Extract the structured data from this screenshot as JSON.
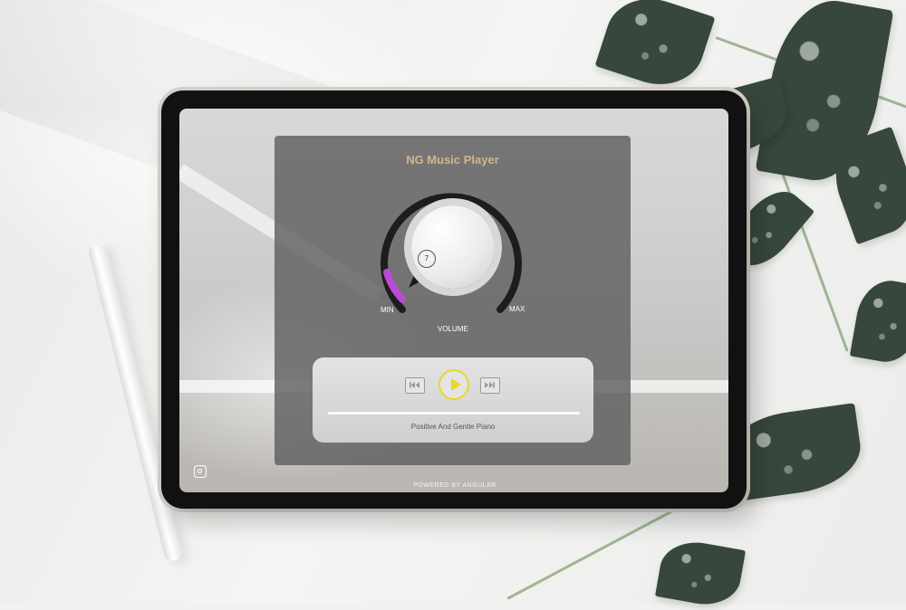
{
  "app": {
    "title": "NG Music Player",
    "footer": "POWERED BY ANGULAR"
  },
  "volume": {
    "label": "VOLUME",
    "min_label": "MIN",
    "max_label": "MAX",
    "value": "7",
    "level_fraction": 0.1
  },
  "controls": {
    "previous_icon": "skip-previous-icon",
    "play_icon": "play-icon",
    "next_icon": "skip-next-icon"
  },
  "track": {
    "name": "Positive And Gentle Piano",
    "progress_fraction": 0.0
  },
  "colors": {
    "title": "#d2b58c",
    "accent_volume": "#b94ad6",
    "play_button": "#e6da22"
  },
  "social": {
    "icon": "instagram-icon"
  }
}
